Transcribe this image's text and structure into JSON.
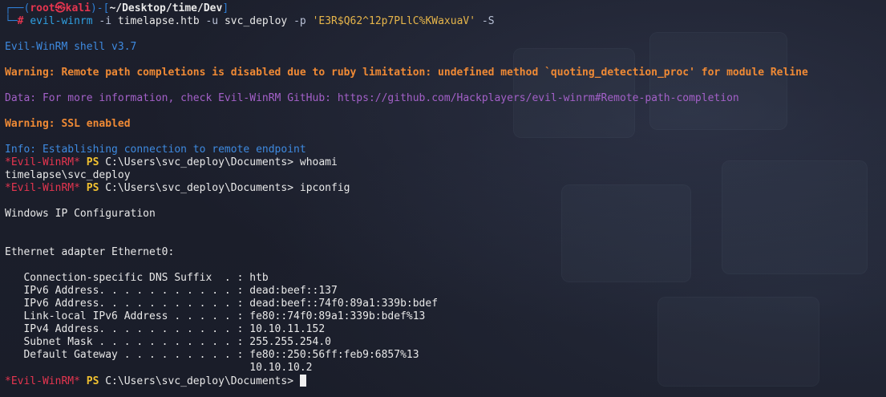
{
  "prompt": {
    "corner_top": "┌──",
    "corner_bottom": "└─",
    "open_paren": "(",
    "user": "root",
    "at_glyph": "㉿",
    "host": "kali",
    "close_paren": ")",
    "dash": "-",
    "open_bracket": "[",
    "path": "~/Desktop/time/Dev",
    "close_bracket": "]",
    "hash": "#"
  },
  "command": {
    "program": "evil-winrm",
    "flag_i": "-i",
    "target": "timelapse.htb",
    "flag_u": "-u",
    "user": "svc_deploy",
    "flag_p": "-p",
    "password": "'E3R$Q62^12p7PLlC%KWaxuaV'",
    "flag_s": "-S"
  },
  "output": {
    "banner": "Evil-WinRM shell v3.7",
    "warning_completion": "Warning: Remote path completions is disabled due to ruby limitation: undefined method `quoting_detection_proc' for module Reline",
    "data_info": "Data: For more information, check Evil-WinRM GitHub: https://github.com/Hackplayers/evil-winrm#Remote-path-completion",
    "warning_ssl": "Warning: SSL enabled",
    "info_connect": "Info: Establishing connection to remote endpoint"
  },
  "ps_prompt": {
    "user": "*Evil-WinRM*",
    "ps": "PS",
    "path": "C:\\Users\\svc_deploy\\Documents>"
  },
  "session": {
    "cmd_whoami": "whoami",
    "whoami_result": "timelapse\\svc_deploy",
    "cmd_ipconfig": "ipconfig",
    "ipconfig_title": "Windows IP Configuration",
    "adapter": "Ethernet adapter Ethernet0:",
    "ipconfig_lines": [
      "   Connection-specific DNS Suffix  . : htb",
      "   IPv6 Address. . . . . . . . . . . : dead:beef::137",
      "   IPv6 Address. . . . . . . . . . . : dead:beef::74f0:89a1:339b:bdef",
      "   Link-local IPv6 Address . . . . . : fe80::74f0:89a1:339b:bdef%13",
      "   IPv4 Address. . . . . . . . . . . : 10.10.11.152",
      "   Subnet Mask . . . . . . . . . . . : 255.255.254.0",
      "   Default Gateway . . . . . . . . . : fe80::250:56ff:feb9:6857%13",
      "                                       10.10.10.2"
    ]
  }
}
